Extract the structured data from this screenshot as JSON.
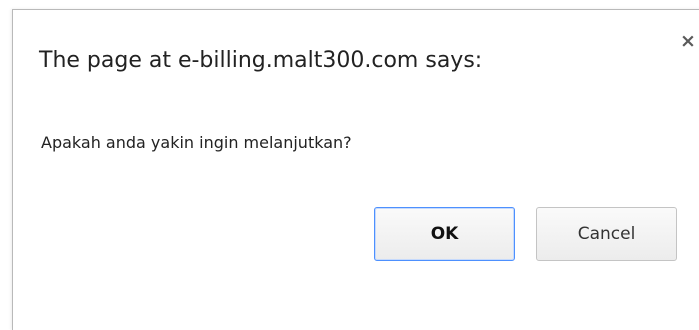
{
  "dialog": {
    "title": "The page at e-billing.malt300.com says:",
    "message": "Apakah anda yakin ingin melanjutkan?",
    "close_label": "×",
    "ok_label": "OK",
    "cancel_label": "Cancel"
  },
  "colors": {
    "focus_border": "#4d90fe",
    "button_border": "#c4c4c4",
    "text": "#222222"
  }
}
